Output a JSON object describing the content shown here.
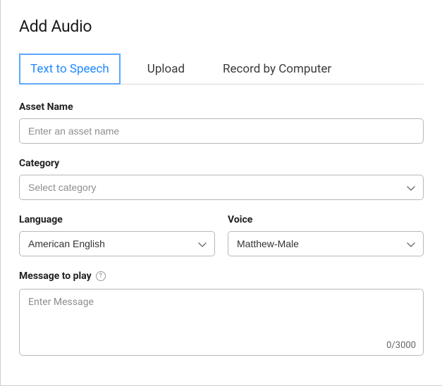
{
  "title": "Add Audio",
  "tabs": [
    {
      "label": "Text to Speech"
    },
    {
      "label": "Upload"
    },
    {
      "label": "Record by Computer"
    }
  ],
  "assetName": {
    "label": "Asset Name",
    "placeholder": "Enter an asset name",
    "value": ""
  },
  "category": {
    "label": "Category",
    "placeholder": "Select category",
    "value": ""
  },
  "language": {
    "label": "Language",
    "value": "American English"
  },
  "voice": {
    "label": "Voice",
    "value": "Matthew-Male"
  },
  "message": {
    "label": "Message to play",
    "placeholder": "Enter Message",
    "value": "",
    "counter": "0/3000"
  }
}
